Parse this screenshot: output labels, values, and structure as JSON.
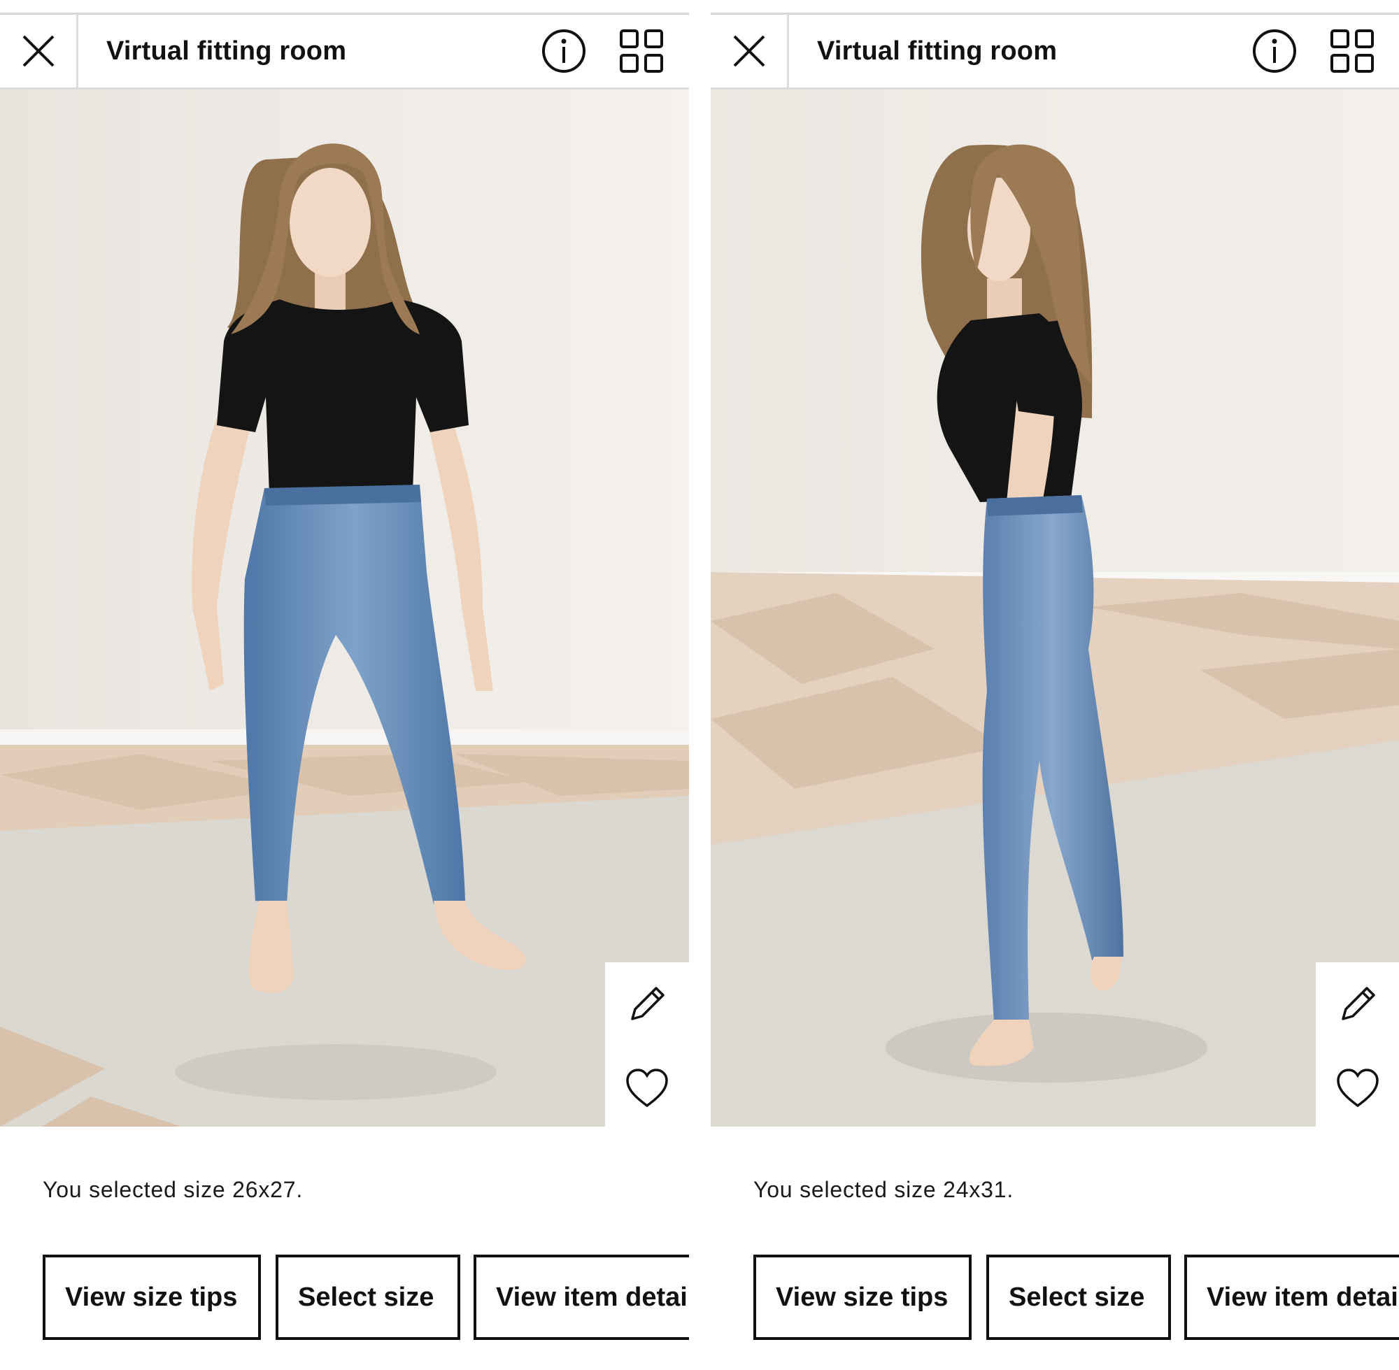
{
  "screens": [
    {
      "view": "front",
      "header": {
        "title": "Virtual fitting room"
      },
      "icons": {
        "close": "close-icon",
        "info": "info-icon",
        "grid": "grid-icon",
        "edit": "pencil-icon",
        "favorite": "heart-icon",
        "bag": "shopping-bag-icon"
      },
      "selected_size_text": "You selected size 26x27.",
      "buttons": {
        "tips": "View size tips",
        "size": "Select size",
        "details": "View item details"
      }
    },
    {
      "view": "side",
      "header": {
        "title": "Virtual fitting room"
      },
      "icons": {
        "close": "close-icon",
        "info": "info-icon",
        "grid": "grid-icon",
        "edit": "pencil-icon",
        "favorite": "heart-icon",
        "bag": "shopping-bag-icon"
      },
      "selected_size_text": "You selected size 24x31.",
      "buttons": {
        "tips": "View size tips",
        "size": "Select size",
        "details": "View item details"
      }
    }
  ],
  "colors": {
    "wall": "#efebe6",
    "floor": "#e3cfbd",
    "rug": "#dcd8d2",
    "shirt": "#141414",
    "denim": "#5f86b5",
    "hair": "#9b7a55",
    "skin": "#efd3bd"
  }
}
